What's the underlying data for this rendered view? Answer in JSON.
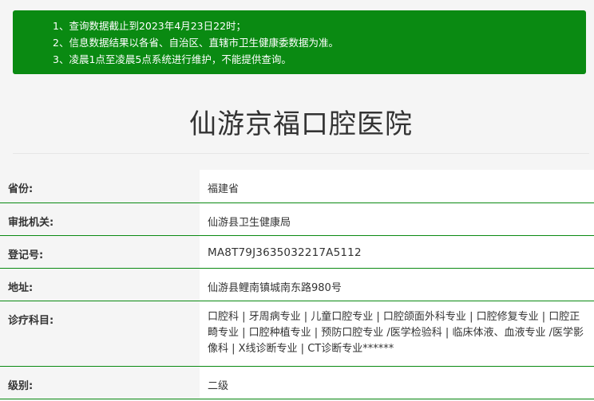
{
  "notice": {
    "lines": [
      "1、查询数据截止到2023年4月23日22时；",
      "2、信息数据结果以各省、自治区、直辖市卫生健康委数据为准。",
      "3、凌晨1点至凌晨5点系统进行维护，不能提供查询。"
    ],
    "bg_color": "#0a8a12"
  },
  "hospital": {
    "name": "仙游京福口腔医院"
  },
  "fields": {
    "province": {
      "label": "省份:",
      "value": "福建省"
    },
    "authority": {
      "label": "审批机关:",
      "value": "仙游县卫生健康局"
    },
    "registration": {
      "label": "登记号:",
      "value": "MA8T79J3635032217A5112"
    },
    "address": {
      "label": "地址:",
      "value": "仙游县鲤南镇城南东路980号"
    },
    "departments": {
      "label": "诊疗科目:",
      "value": "口腔科 | 牙周病专业 | 儿童口腔专业 | 口腔颌面外科专业 | 口腔修复专业 | 口腔正畸专业 | 口腔种植专业 | 预防口腔专业 /医学检验科 | 临床体液、血液专业 /医学影像科 | X线诊断专业 | CT诊断专业******"
    },
    "level": {
      "label": "级别:",
      "value": "二级"
    }
  }
}
